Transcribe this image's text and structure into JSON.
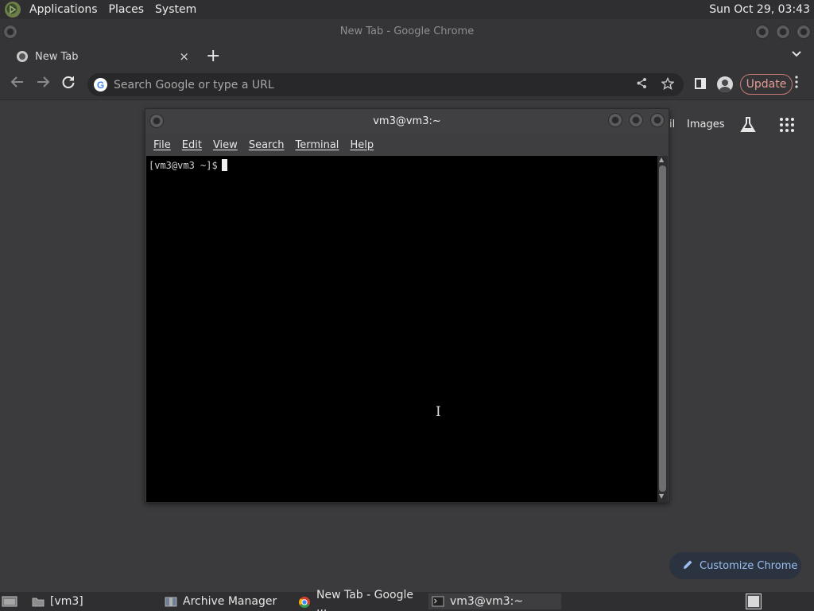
{
  "top_panel": {
    "menus": [
      "Applications",
      "Places",
      "System"
    ],
    "clock": "Sun Oct 29, 03:43"
  },
  "chrome": {
    "window_title": "New Tab - Google Chrome",
    "tab_title": "New Tab",
    "tab_close": "×",
    "new_tab": "+",
    "omnibox_placeholder": "Search Google or type a URL",
    "update_label": "Update",
    "gmail_partial": "il",
    "images_label": "Images",
    "customize_label": "Customize Chrome"
  },
  "terminal": {
    "title": "vm3@vm3:~",
    "menu": [
      "File",
      "Edit",
      "View",
      "Search",
      "Terminal",
      "Help"
    ],
    "prompt": "[vm3@vm3 ~]$"
  },
  "taskbar": {
    "items": [
      {
        "label": "[vm3]",
        "icon": "folder-icon"
      },
      {
        "label": "Archive Manager",
        "icon": "archive-icon"
      },
      {
        "label": "New Tab - Google ...",
        "icon": "chrome-icon"
      },
      {
        "label": "vm3@vm3:~",
        "icon": "terminal-icon",
        "active": true
      }
    ]
  },
  "colors": {
    "panel_bg": "#2f2f31",
    "chrome_bg": "#353537",
    "update_accent": "#e39d94",
    "customize_accent": "#9bbff0"
  }
}
